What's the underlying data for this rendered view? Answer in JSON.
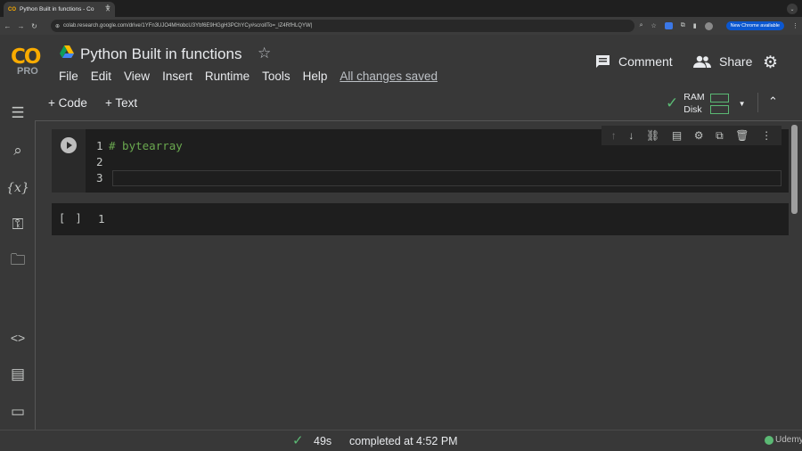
{
  "browser": {
    "tab_title": "Python Built in functions - Co",
    "tab_favicon": "CO",
    "url": "colab.research.google.com/drive/1YFn3UJO4MHobcU3Ybf6E9HGgH3PChYCy#scrollTo=_lZ4RfHLQYW|",
    "new_chrome_label": "New Chrome available"
  },
  "header": {
    "logo_text": "CO",
    "logo_sub": "PRO",
    "title": "Python Built in functions",
    "menu": [
      "File",
      "Edit",
      "View",
      "Insert",
      "Runtime",
      "Tools",
      "Help"
    ],
    "saved_status": "All changes saved",
    "comment_label": "Comment",
    "share_label": "Share"
  },
  "toolbar": {
    "add_code": "+ Code",
    "add_text": "+ Text",
    "ram_label": "RAM",
    "disk_label": "Disk"
  },
  "cells": [
    {
      "lines": [
        {
          "num": "1",
          "text": "# bytearray"
        },
        {
          "num": "2",
          "text": ""
        },
        {
          "num": "3",
          "text": ""
        }
      ]
    },
    {
      "exec": "[ ]",
      "lines": [
        {
          "num": "1",
          "text": ""
        }
      ]
    }
  ],
  "status": {
    "duration": "49s",
    "completed": "completed at 4:52 PM"
  },
  "watermark": "Udemy",
  "colors": {
    "accent_orange": "#f9ab00",
    "status_green": "#5bb974",
    "comment_green": "#6aa84f"
  }
}
